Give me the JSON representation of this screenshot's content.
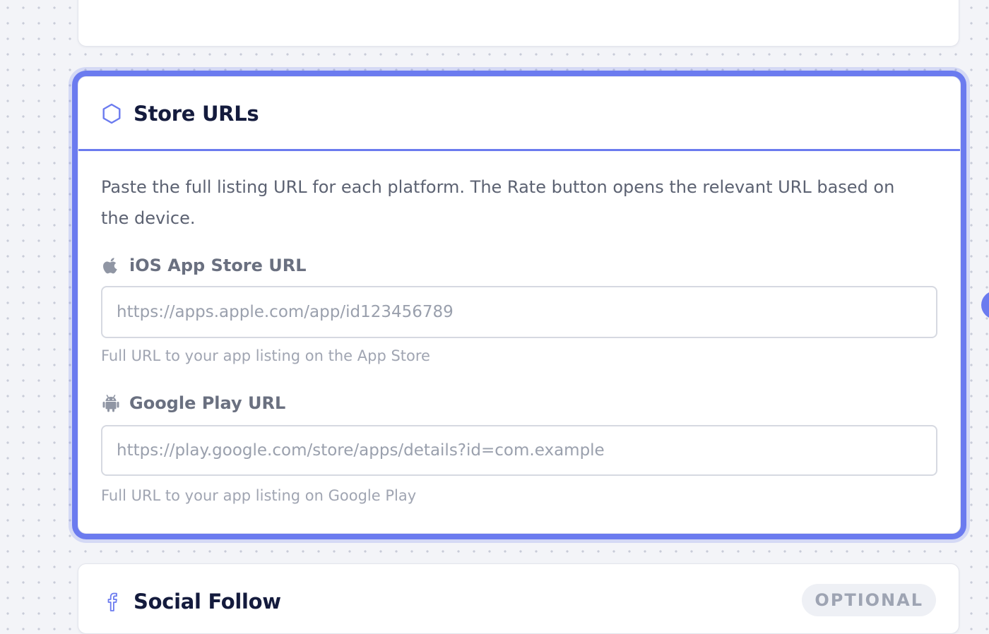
{
  "store_urls": {
    "title": "Store URLs",
    "icon": "hexagon-icon",
    "description": "Paste the full listing URL for each platform. The Rate button opens the relevant URL based on the device.",
    "ios": {
      "label": "iOS App Store URL",
      "icon": "apple-icon",
      "value": "",
      "placeholder": "https://apps.apple.com/app/id123456789",
      "help": "Full URL to your app listing on the App Store"
    },
    "android": {
      "label": "Google Play URL",
      "icon": "android-icon",
      "value": "",
      "placeholder": "https://play.google.com/store/apps/details?id=com.example",
      "help": "Full URL to your app listing on Google Play"
    }
  },
  "social_follow": {
    "title": "Social Follow",
    "icon": "facebook-icon",
    "badge": "OPTIONAL"
  },
  "colors": {
    "accent": "#6b7bef",
    "title": "#141b3d",
    "label": "#6a7080",
    "muted": "#a0a5b2"
  }
}
